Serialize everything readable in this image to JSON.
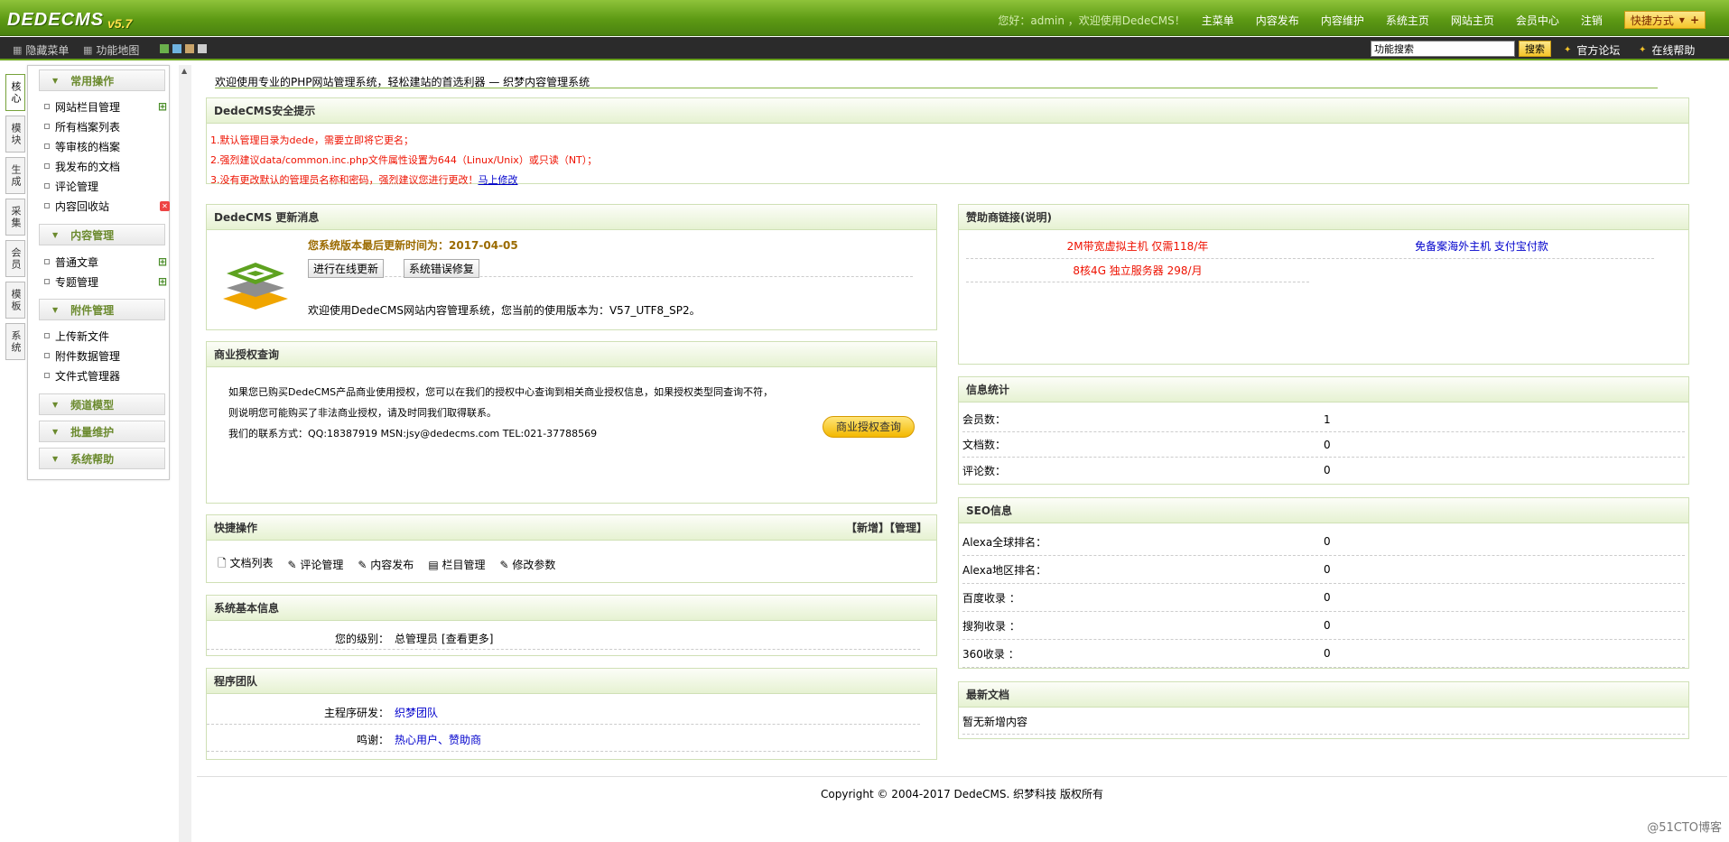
{
  "topbar": {
    "logo_text": "DEDECMS",
    "logo_version": "v5.7",
    "greeting": "您好：admin ，欢迎使用DedeCMS！",
    "nav": [
      "主菜单",
      "内容发布",
      "内容维护",
      "系统主页",
      "网站主页",
      "会员中心",
      "注销"
    ],
    "quick_label": "快捷方式"
  },
  "subbar": {
    "hide_menu": "隐藏菜单",
    "function_map": "功能地图",
    "search_value": "功能搜索",
    "search_button": "搜索",
    "forum": "官方论坛",
    "help": "在线帮助"
  },
  "left_tabs": [
    "核心",
    "模块",
    "生成",
    "采集",
    "会员",
    "模板",
    "系统"
  ],
  "menu": {
    "group1": "常用操作",
    "group1_items": [
      "网站栏目管理",
      "所有档案列表",
      "等审核的档案",
      "我发布的文档",
      "评论管理",
      "内容回收站"
    ],
    "group2": "内容管理",
    "group2_items": [
      "普通文章",
      "专题管理"
    ],
    "group3": "附件管理",
    "group3_items": [
      "上传新文件",
      "附件数据管理",
      "文件式管理器"
    ],
    "group4": "频道模型",
    "group5": "批量维护",
    "group6": "系统帮助"
  },
  "welcome": "欢迎使用专业的PHP网站管理系统，轻松建站的首选利器 — 织梦内容管理系统",
  "security": {
    "title": "DedeCMS安全提示",
    "line1": "1.默认管理目录为dede，需要立即将它更名；",
    "line2": "2.强烈建议data/common.inc.php文件属性设置为644（Linux/Unix）或只读（NT）；",
    "line3": "3.没有更改默认的管理员名称和密码，强烈建议您进行更改！",
    "line3_link": "马上修改"
  },
  "update": {
    "title": "DedeCMS 更新消息",
    "last_update": "您系统版本最后更新时间为：2017-04-05",
    "btn_online": "进行在线更新",
    "btn_fix": "系统错误修复",
    "version_text": "欢迎使用DedeCMS网站内容管理系统，您当前的使用版本为：V57_UTF8_SP2。"
  },
  "license": {
    "title": "商业授权查询",
    "line1": "如果您已购买DedeCMS产品商业使用授权，您可以在我们的授权中心查询到相关商业授权信息，如果授权类型同查询不符，",
    "line2": "则说明您可能购买了非法商业授权，请及时同我们取得联系。",
    "line3": "我们的联系方式：QQ:18387919 MSN:jsy@dedecms.com TEL:021-37788569",
    "button": "商业授权查询"
  },
  "quick_ops": {
    "title": "快捷操作",
    "header_right": "【新增】【管理】",
    "items": [
      "文档列表",
      "评论管理",
      "内容发布",
      "栏目管理",
      "修改参数"
    ]
  },
  "sysinfo": {
    "title": "系统基本信息",
    "label": "您的级别：",
    "value": "总管理员",
    "more": "[查看更多]"
  },
  "team": {
    "title": "程序团队",
    "dev_label": "主程序研发：",
    "dev_value": "织梦团队",
    "thanks_label": "鸣谢：",
    "thanks_value": "热心用户、赞助商"
  },
  "sponsor": {
    "title": "赞助商链接(说明)",
    "link1": "2M带宽虚拟主机 仅需118/年",
    "link2": "免备案海外主机 支付宝付款",
    "link3": "8核4G 独立服务器 298/月"
  },
  "stats": {
    "title": "信息统计",
    "rows": [
      {
        "label": "会员数：",
        "value": "1"
      },
      {
        "label": "文档数：",
        "value": "0"
      },
      {
        "label": "评论数：",
        "value": "0"
      }
    ]
  },
  "seo": {
    "title": "SEO信息",
    "rows": [
      {
        "label": "Alexa全球排名：",
        "value": "0"
      },
      {
        "label": "Alexa地区排名：",
        "value": "0"
      },
      {
        "label": "百度收录 ：",
        "value": "0"
      },
      {
        "label": "搜狗收录 ：",
        "value": "0"
      },
      {
        "label": "360收录 ：",
        "value": "0"
      }
    ]
  },
  "latest": {
    "title": "最新文档",
    "text": "暂无新增内容"
  },
  "footer": "Copyright © 2004-2017 DedeCMS. 织梦科技 版权所有",
  "watermark": "@51CTO博客"
}
